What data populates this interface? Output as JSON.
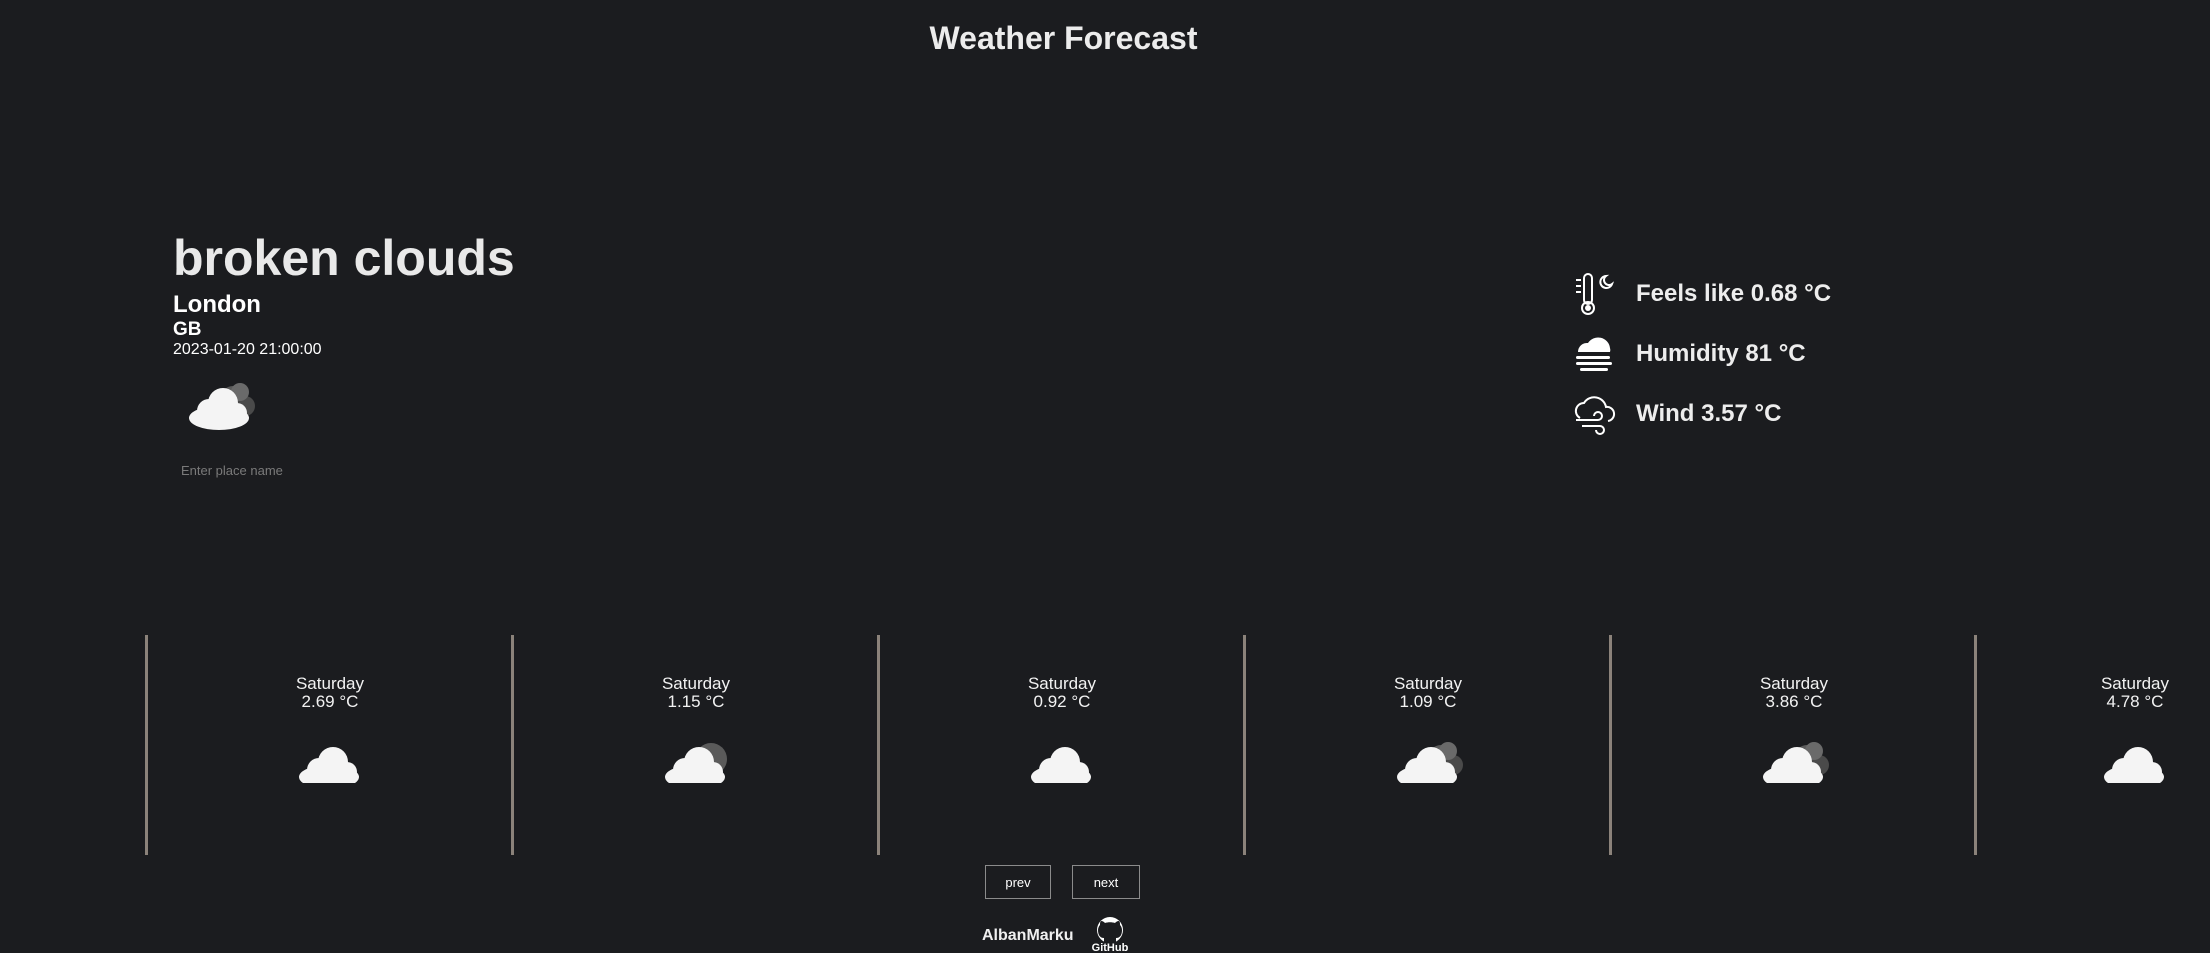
{
  "header": {
    "title": "Weather Forecast"
  },
  "current": {
    "description": "broken clouds",
    "city": "London",
    "country": "GB",
    "datetime": "2023-01-20 21:00:00",
    "icon": "broken-clouds-icon"
  },
  "search": {
    "placeholder": "Enter place name",
    "value": ""
  },
  "details": {
    "feels_like": "Feels like 0.68 °C",
    "humidity": "Humidity 81 °C",
    "wind": "Wind 3.57 °C"
  },
  "forecast": [
    {
      "day": "Saturday",
      "temp": "2.69 °C",
      "icon": "cloud-icon"
    },
    {
      "day": "Saturday",
      "temp": "1.15 °C",
      "icon": "cloud-moon-icon"
    },
    {
      "day": "Saturday",
      "temp": "0.92 °C",
      "icon": "cloud-icon"
    },
    {
      "day": "Saturday",
      "temp": "1.09 °C",
      "icon": "broken-clouds-icon"
    },
    {
      "day": "Saturday",
      "temp": "3.86 °C",
      "icon": "broken-clouds-icon"
    },
    {
      "day": "Saturday",
      "temp": "4.78 °C",
      "icon": "cloud-icon"
    }
  ],
  "pagination": {
    "prev_label": "prev",
    "next_label": "next"
  },
  "footer": {
    "author": "AlbanMarku",
    "github_label": "GitHub"
  },
  "colors": {
    "background": "#1b1c1f",
    "divider": "#8b827a",
    "text": "#ffffff"
  }
}
